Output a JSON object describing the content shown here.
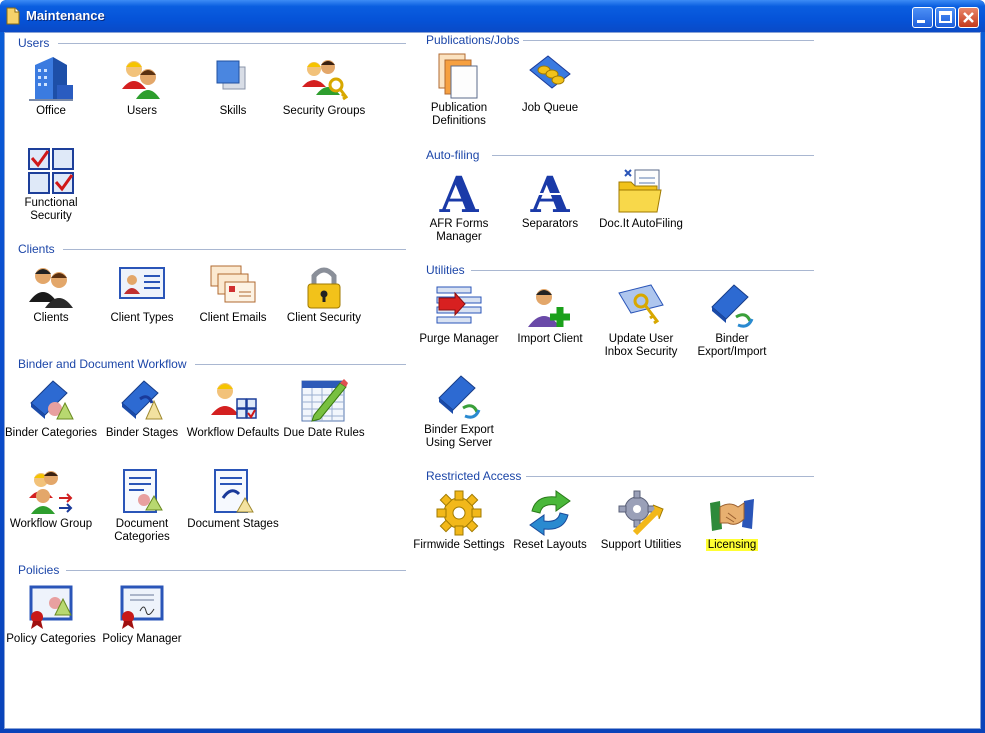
{
  "window": {
    "title": "Maintenance"
  },
  "groups": {
    "users": {
      "title": "Users",
      "items": [
        "Office",
        "Users",
        "Skills",
        "Security Groups",
        "Functional\nSecurity"
      ]
    },
    "clients": {
      "title": "Clients",
      "items": [
        "Clients",
        "Client Types",
        "Client Emails",
        "Client Security"
      ]
    },
    "binder": {
      "title": "Binder and Document Workflow",
      "items": [
        "Binder Categories",
        "Binder Stages",
        "Workflow Defaults",
        "Due Date Rules",
        "Workflow Group",
        "Document\nCategories",
        "Document Stages"
      ]
    },
    "policies": {
      "title": "Policies",
      "items": [
        "Policy Categories",
        "Policy Manager"
      ]
    },
    "publications": {
      "title": "Publications/Jobs",
      "items": [
        "Publication\nDefinitions",
        "Job Queue"
      ]
    },
    "autofiling": {
      "title": "Auto-filing",
      "items": [
        "AFR Forms\nManager",
        "Separators",
        "Doc.It AutoFiling"
      ]
    },
    "utilities": {
      "title": "Utilities",
      "items": [
        "Purge Manager",
        "Import Client",
        "Update User\nInbox Security",
        "Binder\nExport/Import",
        "Binder Export\nUsing Server"
      ]
    },
    "restricted": {
      "title": "Restricted Access",
      "items": [
        "Firmwide Settings",
        "Reset Layouts",
        "Support Utilities",
        "Licensing"
      ]
    }
  },
  "colors": {
    "group_title": "#1c46a8",
    "highlight": "#ffff33",
    "titlebar": "#0553d8"
  }
}
